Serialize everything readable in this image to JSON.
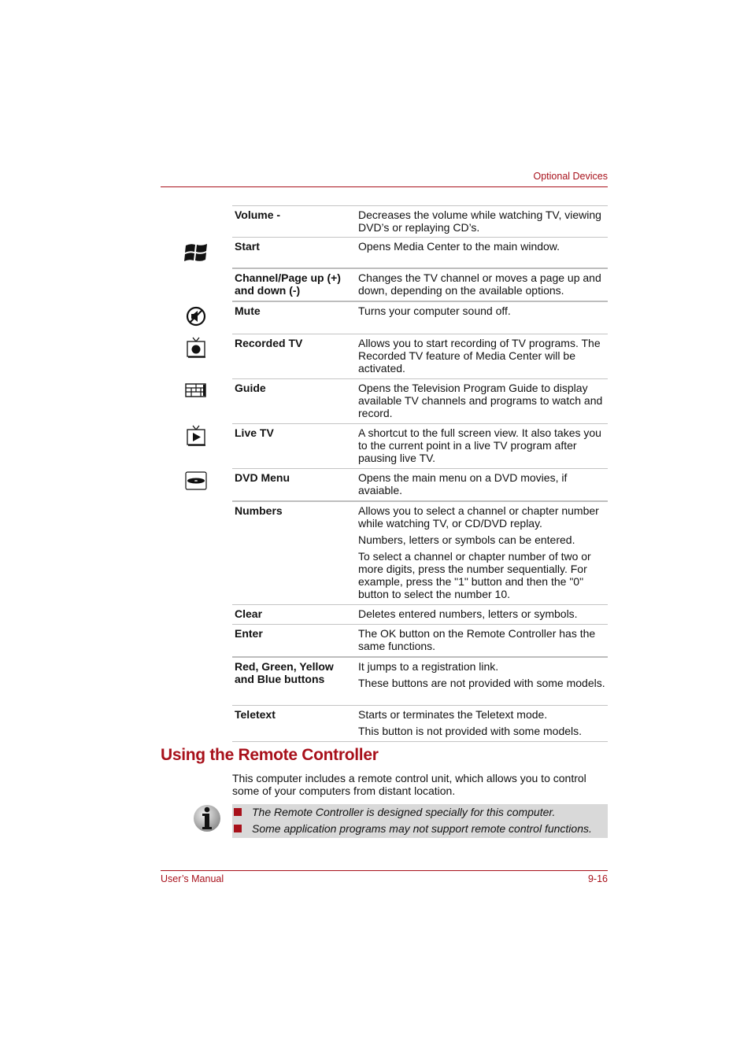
{
  "header": {
    "title": "Optional Devices"
  },
  "table": {
    "rows": [
      {
        "key": "Volume -",
        "icon": null,
        "desc": [
          "Decreases the volume while watching TV, viewing DVD’s or replaying CD’s."
        ]
      },
      {
        "key": "Start",
        "icon": "windows-logo-icon",
        "desc": [
          "Opens Media Center to the main window."
        ]
      },
      {
        "key": "Channel/Page up (+) and down (-)",
        "icon": null,
        "desc": [
          "Changes the TV channel or moves a page up and down, depending on the available options."
        ]
      },
      {
        "key": "Mute",
        "icon": "mute-icon",
        "desc": [
          "Turns your computer sound off."
        ]
      },
      {
        "key": "Recorded TV",
        "icon": "recorded-tv-icon",
        "desc": [
          "Allows you to start recording of TV programs. The Recorded TV feature of Media Center will be activated."
        ]
      },
      {
        "key": "Guide",
        "icon": "guide-icon",
        "desc": [
          "Opens the Television Program Guide to display available TV channels and programs to watch and record."
        ]
      },
      {
        "key": "Live TV",
        "icon": "live-tv-icon",
        "desc": [
          "A shortcut to the full screen view. It also takes you to the current point in a live TV program after pausing live TV."
        ]
      },
      {
        "key": "DVD Menu",
        "icon": "dvd-menu-icon",
        "desc": [
          "Opens the main menu on a DVD movies, if avaiable."
        ]
      },
      {
        "key": "Numbers",
        "icon": null,
        "desc": [
          "Allows you to select a channel or chapter number while watching TV, or CD/DVD replay.",
          "Numbers, letters or symbols can be entered.",
          "To select a channel or chapter number of two or more digits, press the number sequentially. For example, press the \"1\" button and then the \"0\" button to select the number 10."
        ]
      },
      {
        "key": "Clear",
        "icon": null,
        "desc": [
          "Deletes entered numbers, letters or symbols."
        ]
      },
      {
        "key": "Enter",
        "icon": null,
        "desc": [
          "The OK button on the Remote Controller has the same functions."
        ]
      },
      {
        "key": "Red, Green, Yellow and Blue buttons",
        "icon": null,
        "desc": [
          "It jumps to a registration link.",
          "These buttons are not provided with some models."
        ]
      },
      {
        "key": "Teletext",
        "icon": null,
        "desc": [
          "Starts or terminates the Teletext mode.",
          "This button is not provided with some models."
        ]
      }
    ]
  },
  "section": {
    "heading": "Using the Remote Controller",
    "intro": "This computer includes a remote control unit, which allows you to control some of your computers from distant location.",
    "notes": [
      "The Remote Controller is designed specially for this computer.",
      "Some application programs may not support remote control functions."
    ]
  },
  "footer": {
    "left": "User’s Manual",
    "right": "9-16"
  },
  "colors": {
    "accent": "#a8111b",
    "note_bg": "#d9d9d9",
    "rule": "#c4c4c4"
  }
}
